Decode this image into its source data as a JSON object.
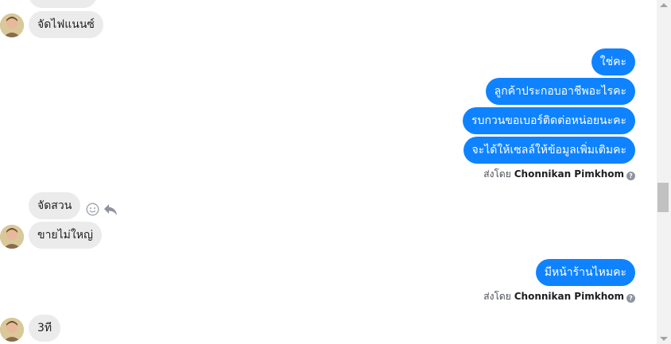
{
  "incoming": [
    {
      "text": "จัดไฟแนนซ์"
    },
    {
      "text": "จัดสวน"
    },
    {
      "text": "ขายไม่ใหญ่"
    },
    {
      "text": "3ที"
    }
  ],
  "outgoing": [
    {
      "text": "ใช่คะ"
    },
    {
      "text": "ลูกค้าประกอบอาชีพอะไรคะ"
    },
    {
      "text": "รบกวนขอเบอร์ติดต่อหน่อยนะคะ"
    },
    {
      "text": "จะได้ให้เซลล์ให้ข้อมูลเพิ่มเติมคะ"
    },
    {
      "text": "มีหน้าร้านไหมคะ"
    }
  ],
  "sent_by": {
    "prefix": "ส่งโดย",
    "name": "Chonnikan Pimkhom"
  },
  "icons": {
    "info": "question-circle-icon",
    "react": "smiley-icon",
    "reply": "reply-arrow-icon",
    "avatar": "user-avatar"
  },
  "colors": {
    "outgoing_bubble": "#0f83ff",
    "incoming_bubble": "#ebebeb",
    "scrollbar_thumb": "#c1c1c1"
  }
}
